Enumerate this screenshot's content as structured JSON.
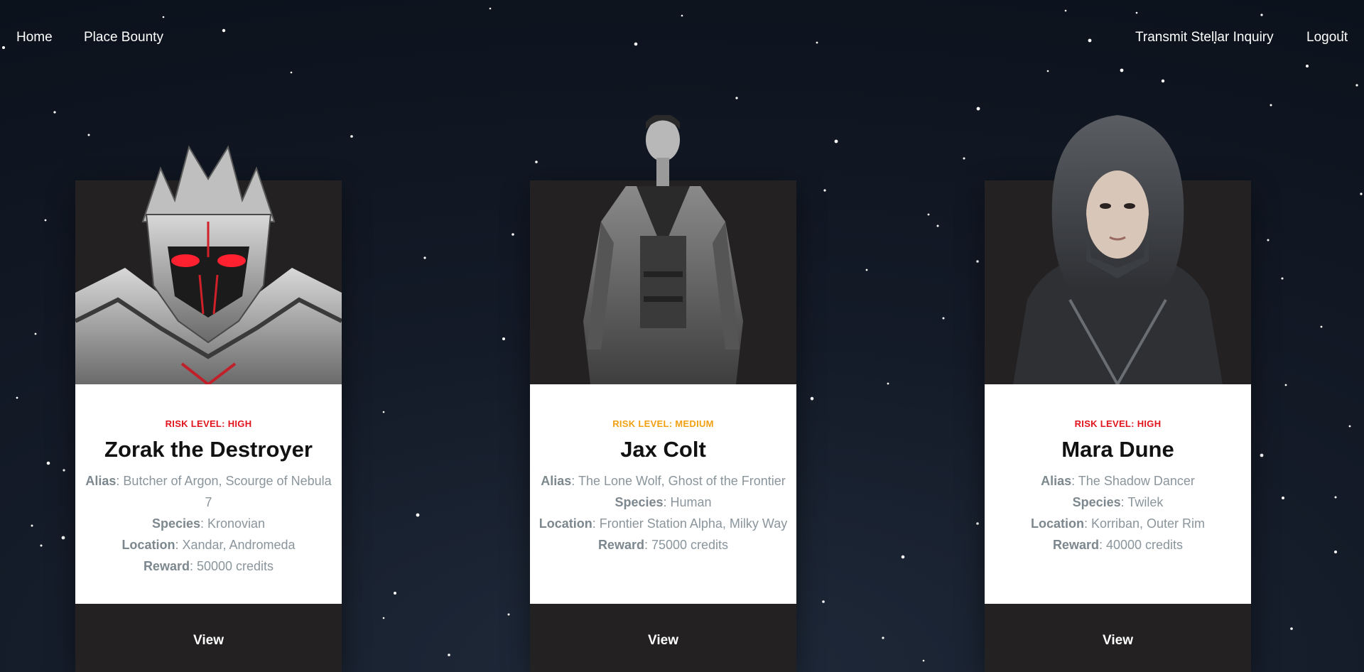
{
  "nav": {
    "left": [
      {
        "label": "Home"
      },
      {
        "label": "Place Bounty"
      }
    ],
    "right": [
      {
        "label": "Transmit Stellar Inquiry"
      },
      {
        "label": "Logout"
      }
    ]
  },
  "colors": {
    "risk_high": "#e0141c",
    "risk_medium": "#f0a010",
    "card_dark": "#232121",
    "background": "#0c121c"
  },
  "bounties": [
    {
      "risk": "RISK LEVEL: HIGH",
      "risk_level": "high",
      "name": "Zorak the Destroyer",
      "alias_label": "Alias",
      "alias": ": Butcher of Argon, Scourge of Nebula 7",
      "species_label": "Species",
      "species": ": Kronovian",
      "location_label": "Location",
      "location": ": Xandar, Andromeda",
      "reward_label": "Reward",
      "reward": ": 50000 credits",
      "view_label": "View",
      "portrait_icon": "armored-alien-portrait"
    },
    {
      "risk": "RISK LEVEL: MEDIUM",
      "risk_level": "medium",
      "name": "Jax Colt",
      "alias_label": "Alias",
      "alias": ": The Lone Wolf, Ghost of the Frontier",
      "species_label": "Species",
      "species": ": Human",
      "location_label": "Location",
      "location": ": Frontier Station Alpha, Milky Way",
      "reward_label": "Reward",
      "reward": ": 75000 credits",
      "view_label": "View",
      "portrait_icon": "trenchcoat-man-portrait"
    },
    {
      "risk": "RISK LEVEL: HIGH",
      "risk_level": "high",
      "name": "Mara Dune",
      "alias_label": "Alias",
      "alias": ": The Shadow Dancer",
      "species_label": "Species",
      "species": ": Twilek",
      "location_label": "Location",
      "location": ": Korriban, Outer Rim",
      "reward_label": "Reward",
      "reward": ": 40000 credits",
      "view_label": "View",
      "portrait_icon": "hooded-woman-portrait"
    }
  ]
}
